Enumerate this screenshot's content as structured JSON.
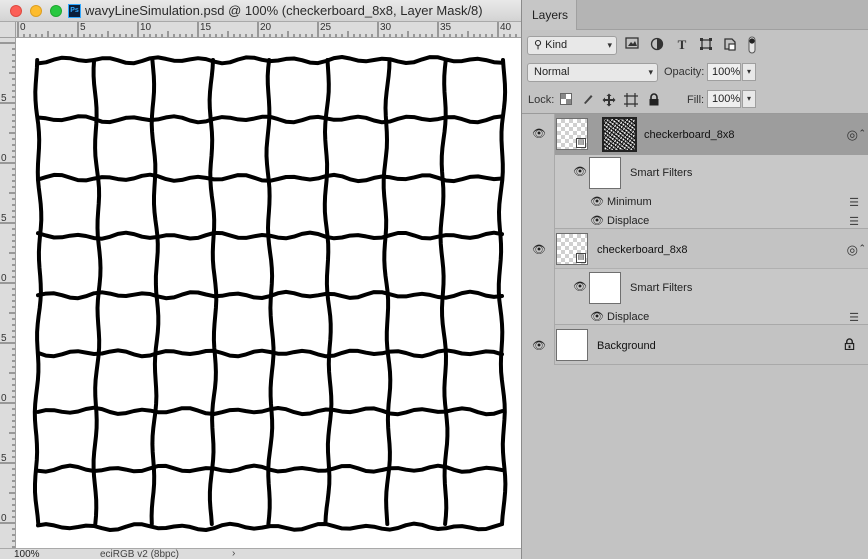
{
  "window": {
    "title": "wavyLineSimulation.psd @ 100% (checkerboard_8x8, Layer Mask/8)",
    "app_icon": "Ps"
  },
  "rulers": {
    "horizontal_labels": [
      "0",
      "5",
      "10",
      "15",
      "20",
      "25",
      "30",
      "35",
      "40"
    ],
    "vertical_labels": [
      "5",
      "0",
      "5",
      "0",
      "5",
      "0",
      "5",
      "0",
      "4"
    ]
  },
  "statusbar": {
    "zoom": "100%",
    "doc_info": "eciRGB v2 (8bpc)",
    "arrow": "›"
  },
  "panel": {
    "tab_label": "Layers",
    "filter": {
      "kind_label": "Kind",
      "search_icon": "search-icon"
    },
    "blend_mode": "Normal",
    "opacity_label": "Opacity:",
    "opacity_value": "100%",
    "lock_label": "Lock:",
    "fill_label": "Fill:",
    "fill_value": "100%",
    "layers": [
      {
        "name": "checkerboard_8x8",
        "selected": true,
        "has_mask": true,
        "smart_filters_label": "Smart Filters",
        "filters": [
          "Minimum",
          "Displace"
        ]
      },
      {
        "name": "checkerboard_8x8",
        "selected": false,
        "has_mask": false,
        "smart_filters_label": "Smart Filters",
        "filters": [
          "Displace"
        ]
      },
      {
        "name": "Background",
        "selected": false,
        "locked": true
      }
    ]
  },
  "colors": {
    "selected_row": "#9d9d9d",
    "panel_bg": "#c3c3c3",
    "canvas_bg": "#ffffff",
    "grid_line": "#000000"
  },
  "icons": {
    "visibility": "eye-icon",
    "lock": "lock-icon",
    "smart_object": "smart-object-badge-icon",
    "filter_options": "filter-options-icon",
    "link": "link-icon"
  }
}
